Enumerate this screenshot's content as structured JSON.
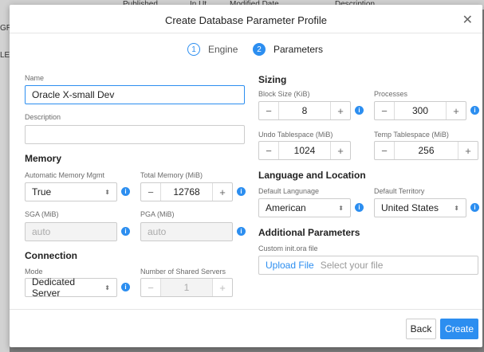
{
  "background": {
    "frag_1": "Published",
    "frag_2": "In Ut",
    "frag_3": "Modified Date",
    "frag_4": "Description",
    "left_1": "GR",
    "left_2": "LE"
  },
  "modal": {
    "title": "Create Database Parameter Profile",
    "close_glyph": "✕",
    "steps": [
      {
        "num": "1",
        "label": "Engine"
      },
      {
        "num": "2",
        "label": "Parameters"
      }
    ]
  },
  "left": {
    "name_label": "Name",
    "name_value": "Oracle X-small Dev",
    "description_label": "Description",
    "description_value": "",
    "memory_heading": "Memory",
    "auto_mem_label": "Automatic Memory Mgmt",
    "auto_mem_value": "True",
    "total_mem_label": "Total Memory (MiB)",
    "total_mem_value": "12768",
    "sga_label": "SGA (MiB)",
    "sga_value": "auto",
    "pga_label": "PGA (MiB)",
    "pga_value": "auto",
    "connection_heading": "Connection",
    "mode_label": "Mode",
    "mode_value": "Dedicated Server",
    "shared_servers_label": "Number of Shared Servers",
    "shared_servers_value": "1"
  },
  "right": {
    "sizing_heading": "Sizing",
    "block_size_label": "Block Size (KiB)",
    "block_size_value": "8",
    "processes_label": "Processes",
    "processes_value": "300",
    "undo_label": "Undo Tablespace (MiB)",
    "undo_value": "1024",
    "temp_label": "Temp Tablespace (MiB)",
    "temp_value": "256",
    "lang_heading": "Language and Location",
    "default_language_label": "Default Langunage",
    "default_language_value": "American",
    "default_territory_label": "Default Territory",
    "default_territory_value": "United States",
    "additional_heading": "Additional Parameters",
    "custom_init_label": "Custom init.ora file",
    "upload_label": "Upload File",
    "upload_placeholder": "Select your file"
  },
  "glyphs": {
    "minus": "−",
    "plus": "+",
    "info": "i",
    "select_arrow": "⬍"
  },
  "footer": {
    "back_label": "Back",
    "create_label": "Create"
  },
  "colors": {
    "accent": "#2c8ef0"
  }
}
